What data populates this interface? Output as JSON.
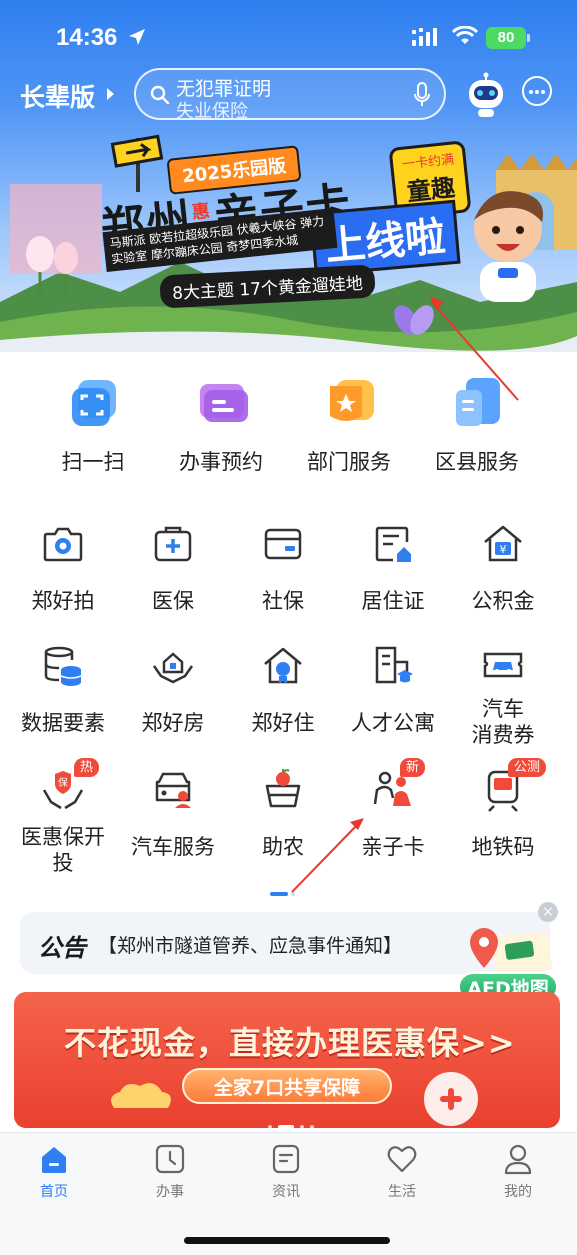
{
  "status_bar": {
    "time": "14:36",
    "battery": "80"
  },
  "header": {
    "elder_mode": "长辈版",
    "search": {
      "line1": "无犯罪证明",
      "line2": "失业保险"
    }
  },
  "banner": {
    "year_tag": "2025乐园版",
    "title": "郑州",
    "title_hui": "惠玩",
    "title_card": "亲子卡",
    "badge_top": "一卡约满",
    "badge_main": "童趣",
    "online": "上线啦",
    "places": "马斯派 欧若拉超级乐园 伏羲大峡谷 弹力实验室 摩尔蹦床公园 奇梦四季水城",
    "tagline": "8大主题 17个黄金遛娃地"
  },
  "quick_services": [
    {
      "label": "扫一扫",
      "icon": "scan-icon"
    },
    {
      "label": "办事预约",
      "icon": "appointment-icon"
    },
    {
      "label": "部门服务",
      "icon": "department-icon"
    },
    {
      "label": "区县服务",
      "icon": "district-icon"
    }
  ],
  "grid": [
    {
      "label": "郑好拍",
      "icon": "camera-icon"
    },
    {
      "label": "医保",
      "icon": "medical-insurance-icon"
    },
    {
      "label": "社保",
      "icon": "social-security-icon"
    },
    {
      "label": "居住证",
      "icon": "residence-permit-icon"
    },
    {
      "label": "公积金",
      "icon": "housing-fund-icon"
    },
    {
      "label": "数据要素",
      "icon": "database-icon"
    },
    {
      "label": "郑好房",
      "icon": "house-hands-icon"
    },
    {
      "label": "郑好住",
      "icon": "home-badge-icon"
    },
    {
      "label": "人才公寓",
      "icon": "apartment-icon"
    },
    {
      "label": "汽车\n消费券",
      "label_line1": "汽车",
      "label_line2": "消费券",
      "icon": "car-coupon-icon"
    },
    {
      "label": "医惠保开投",
      "label_line1": "医惠保开",
      "label_line2": "投",
      "icon": "insurance-hands-icon",
      "tag": "热"
    },
    {
      "label": "汽车服务",
      "icon": "car-service-icon"
    },
    {
      "label": "助农",
      "icon": "farm-basket-icon"
    },
    {
      "label": "亲子卡",
      "icon": "family-icon",
      "tag": "新"
    },
    {
      "label": "地铁码",
      "icon": "metro-icon",
      "tag": "公测"
    }
  ],
  "notice": {
    "tag": "公告",
    "text": "【郑州市隧道管养、应急事件通知】"
  },
  "aed": {
    "label": "AED地图"
  },
  "promo": {
    "title": "不花现金，直接办理医惠保>>",
    "pill": "全家7口共享保障"
  },
  "tabs": [
    {
      "label": "首页",
      "icon": "home-icon",
      "active": true
    },
    {
      "label": "办事",
      "icon": "clock-icon",
      "active": false
    },
    {
      "label": "资讯",
      "icon": "news-icon",
      "active": false
    },
    {
      "label": "生活",
      "icon": "heart-icon",
      "active": false
    },
    {
      "label": "我的",
      "icon": "profile-icon",
      "active": false
    }
  ],
  "colors": {
    "brand_blue": "#2f7ff0",
    "tag_red": "#f04a3a",
    "promo_red": "#e9402f",
    "aed_green": "#21a866"
  }
}
